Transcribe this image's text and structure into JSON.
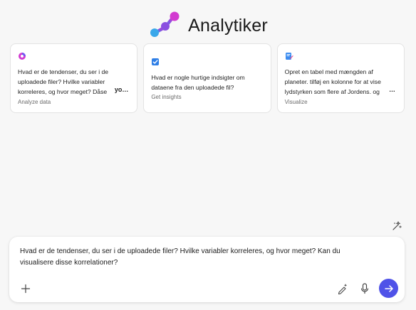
{
  "header": {
    "title": "Analytiker",
    "logo_icon": "molecule-logo-icon"
  },
  "cards": [
    {
      "icon": "chart-pie-icon",
      "text": "Hvad er de tendenser, du ser i de uploadede filer? Hvilke variabler korreleres, og hvor meget? Dåse",
      "ellipsis": "yo…",
      "label": "Analyze data"
    },
    {
      "icon": "checkbox-icon",
      "text": "Hvad er nogle hurtige indsigter om dataene fra den uploadede fil?",
      "ellipsis": "",
      "label": "Get insights"
    },
    {
      "icon": "edit-chart-icon",
      "text": "Opret en tabel med mængden af planeter. tilføj en kolonne for at vise lydstyrken som flere af Jordens. og",
      "ellipsis": "…",
      "label": "Visualize"
    }
  ],
  "composer": {
    "value": "Hvad er de tendenser, du ser i de uploadede filer? Hvilke variabler korreleres, og hvor meget? Kan du visualisere disse korrelationer?",
    "add_icon": "plus-icon",
    "prompt_icon": "sparkle-pen-icon",
    "mic_icon": "microphone-icon",
    "send_icon": "arrow-right-icon"
  },
  "tools_icon": "sparkle-wand-icon",
  "colors": {
    "accent": "#4f52e8",
    "logo_pink": "#d23bd0",
    "logo_purple": "#8a4fe0",
    "logo_blue": "#3aa7ea"
  }
}
